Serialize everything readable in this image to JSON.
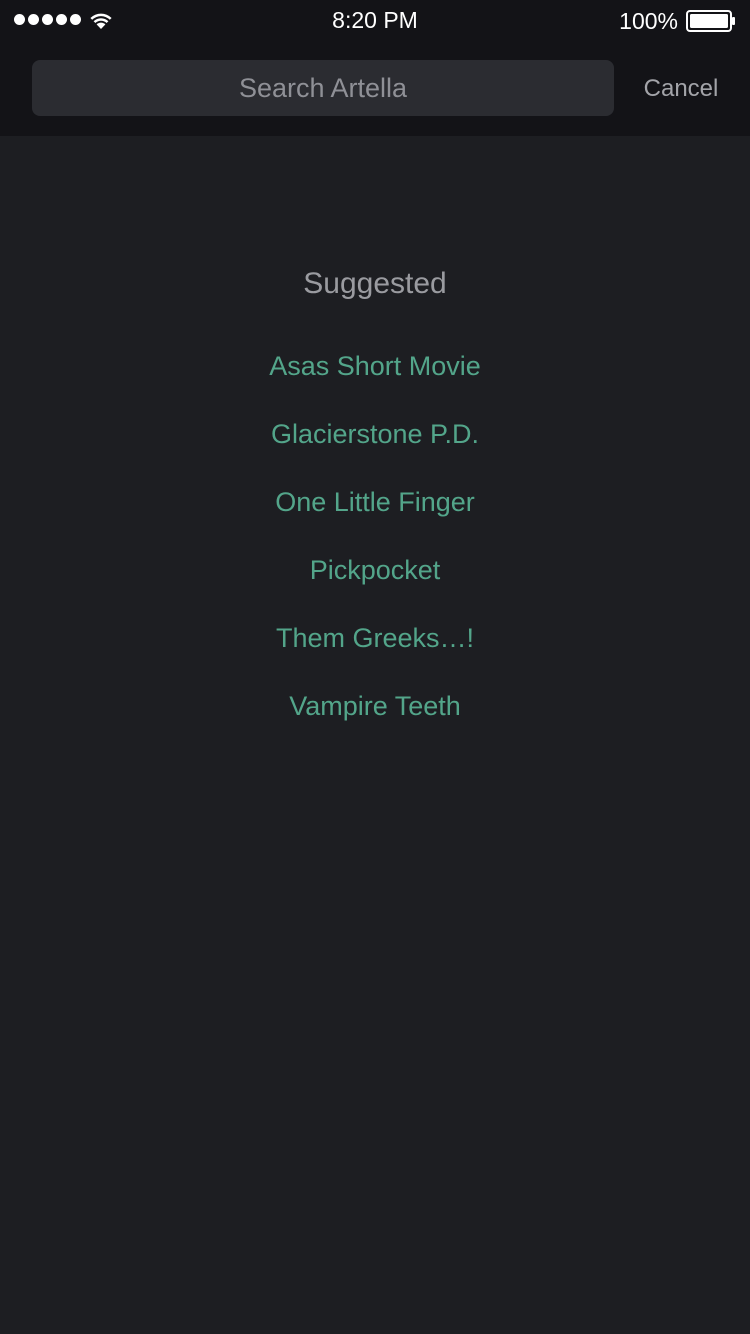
{
  "status_bar": {
    "time": "8:20 PM",
    "battery_percent": "100%",
    "signal_bars": 5,
    "icons": [
      "signal-dots-icon",
      "wifi-icon",
      "battery-icon"
    ]
  },
  "search": {
    "placeholder": "Search Artella",
    "value": "",
    "cancel_label": "Cancel"
  },
  "suggested": {
    "title": "Suggested",
    "items": [
      "Asas Short Movie",
      "Glacierstone P.D.",
      "One Little Finger",
      "Pickpocket",
      "Them Greeks…!",
      "Vampire Teeth"
    ]
  },
  "colors": {
    "background": "#1d1e22",
    "header": "#131317",
    "search_field": "#2b2c31",
    "link_accent": "#53a58a",
    "muted_text": "#9a9ba0"
  }
}
